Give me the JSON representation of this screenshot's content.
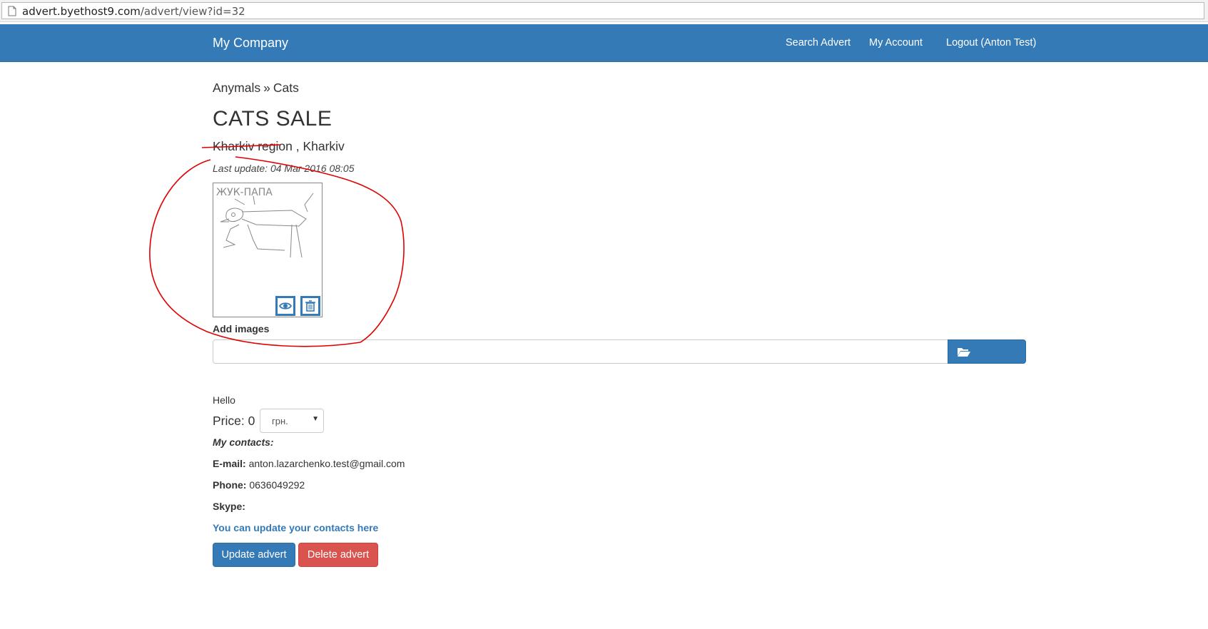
{
  "browser": {
    "url_host": "advert.byethost9.com",
    "url_path": "/advert/view?id=32"
  },
  "navbar": {
    "brand": "My Company",
    "links": [
      "Search Advert",
      "My Account",
      "Logout (Anton Test)"
    ]
  },
  "breadcrumb": {
    "category": "Anymals",
    "separator": "»",
    "subcategory": "Cats"
  },
  "advert": {
    "title": "CATS SALE",
    "location": "Kharkiv region , Kharkiv",
    "last_update": "Last update: 04 Mar 2016 08:05",
    "image_sketch_text": "ЖУК-ПАПА",
    "description": "Hello",
    "price_label": "Price: 0",
    "currency": "грн."
  },
  "images": {
    "add_label": "Add images",
    "file_value": ""
  },
  "contacts": {
    "heading": "My contacts:",
    "email_label": "E-mail:",
    "email": "anton.lazarchenko.test@gmail.com",
    "phone_label": "Phone:",
    "phone": "0636049292",
    "skype_label": "Skype:",
    "skype": "",
    "update_link": "You can update your contacts here"
  },
  "actions": {
    "update": "Update advert",
    "delete": "Delete advert"
  },
  "icons": {
    "thumb_view": "eye-icon",
    "thumb_delete": "trash-icon",
    "browse": "folder-open-icon",
    "page": "page-icon"
  },
  "colors": {
    "primary": "#337ab7",
    "danger": "#d9534f",
    "annotation": "#e00000"
  }
}
